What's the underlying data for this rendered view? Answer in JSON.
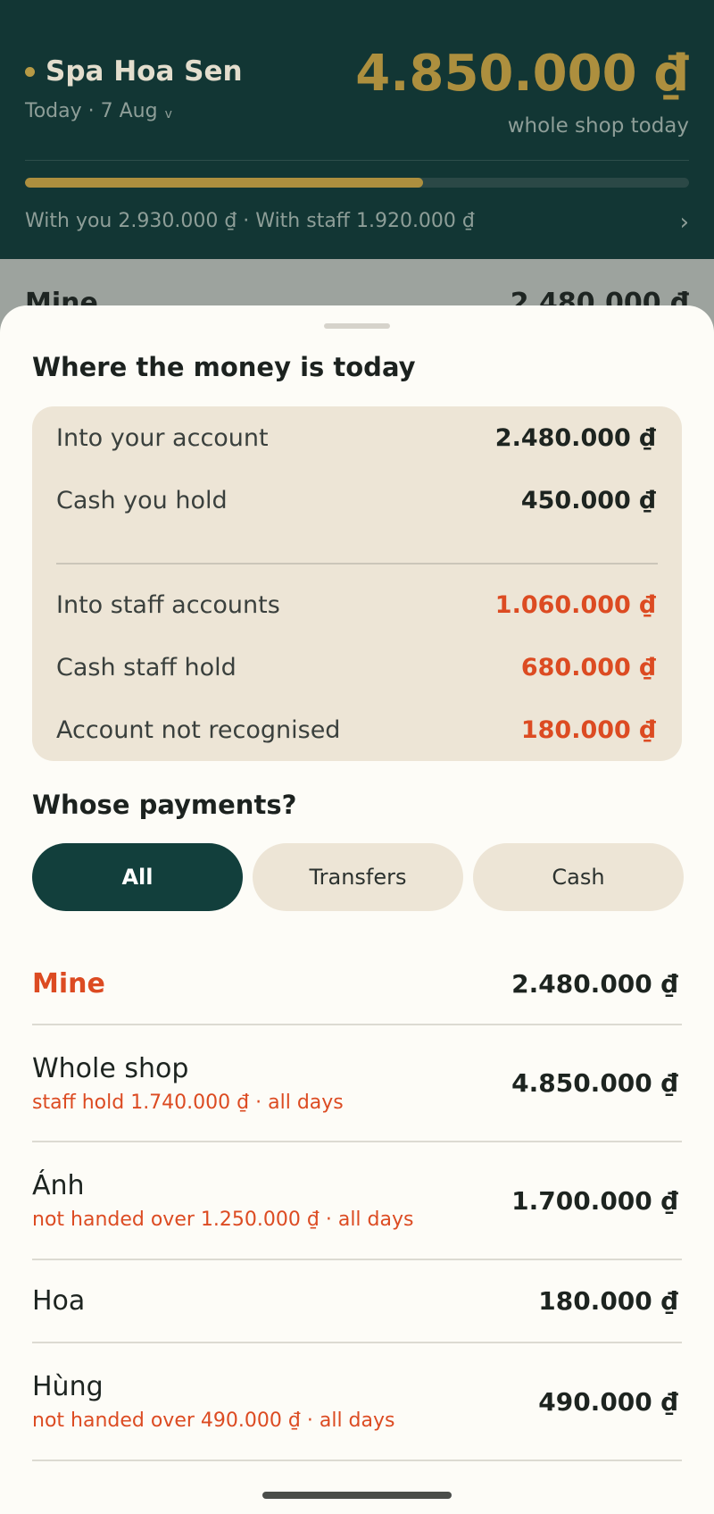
{
  "header": {
    "shop_name": "Spa Hoa Sen",
    "date_label": "Today · 7 Aug",
    "date_chevron": "v",
    "total_amount": "4.850.000 ₫",
    "total_caption": "whole shop today",
    "progress_fraction": 0.6,
    "split_text": "With you 2.930.000 ₫ · With staff 1.920.000 ₫",
    "split_chevron": "›",
    "accent_color": "#ad8f3e",
    "bg_color": "#123634"
  },
  "peek": {
    "left": "Mine",
    "right": "2.480.000 ₫"
  },
  "sheet": {
    "title": "Where the money is today",
    "rows": [
      {
        "label": "Into your account",
        "value": "2.480.000 ₫",
        "highlight": false
      },
      {
        "label": "Cash you hold",
        "value": "450.000 ₫",
        "highlight": false
      },
      {
        "label": "Into staff accounts",
        "value": "1.060.000 ₫",
        "highlight": true
      },
      {
        "label": "Cash staff hold",
        "value": "680.000 ₫",
        "highlight": true
      },
      {
        "label": "Account not recognised",
        "value": "180.000 ₫",
        "highlight": true
      }
    ],
    "filter_title": "Whose payments?",
    "filters": [
      {
        "label": "All",
        "active": true
      },
      {
        "label": "Transfers",
        "active": false
      },
      {
        "label": "Cash",
        "active": false
      }
    ],
    "list": [
      {
        "name": "Mine",
        "sub": "",
        "value": "2.480.000 ₫"
      },
      {
        "name": "Whole shop",
        "sub": "staff hold 1.740.000 ₫ · all days",
        "value": "4.850.000 ₫"
      },
      {
        "name": "Ánh",
        "sub": "not handed over 1.250.000 ₫ · all days",
        "value": "1.700.000 ₫"
      },
      {
        "name": "Hoa",
        "sub": "",
        "value": "180.000 ₫"
      },
      {
        "name": "Hùng",
        "sub": "not handed over 490.000 ₫ · all days",
        "value": "490.000 ₫"
      }
    ],
    "alert_color": "#dc4b22"
  }
}
